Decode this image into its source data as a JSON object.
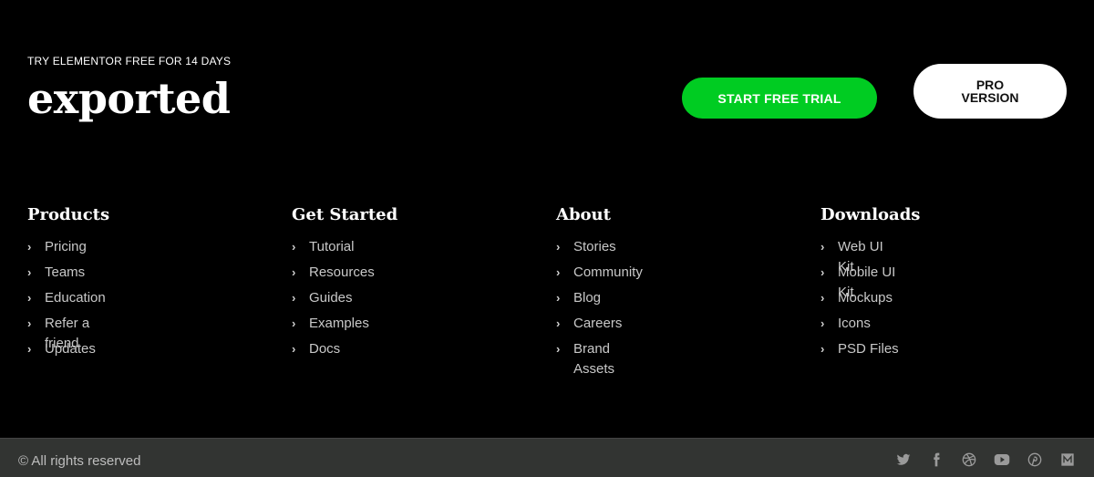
{
  "hero": {
    "eyebrow": "TRY ELEMENTOR FREE FOR 14 DAYS",
    "brand": "exported",
    "trial_button": "START FREE TRIAL",
    "pro_button": "PRO\nVERSION"
  },
  "columns": [
    {
      "title": "Products",
      "items": [
        "Pricing",
        "Teams",
        "Education",
        "Refer a friend",
        "Updates"
      ]
    },
    {
      "title": "Get Started",
      "items": [
        "Tutorial",
        "Resources",
        "Guides",
        "Examples",
        "Docs"
      ]
    },
    {
      "title": "About",
      "items": [
        "Stories",
        "Community",
        "Blog",
        "Careers",
        "Brand Assets"
      ]
    },
    {
      "title": "Downloads",
      "items": [
        "Web UI Kit",
        "Mobile UI Kit",
        "Mockups",
        "Icons",
        "PSD Files"
      ]
    }
  ],
  "footer": {
    "copyright": "© All rights reserved",
    "socials": [
      "twitter-icon",
      "facebook-icon",
      "dribbble-icon",
      "youtube-icon",
      "pinterest-icon",
      "medium-icon"
    ]
  },
  "colors": {
    "accent": "#00cc22",
    "background": "#000000",
    "footer": "#323432"
  }
}
